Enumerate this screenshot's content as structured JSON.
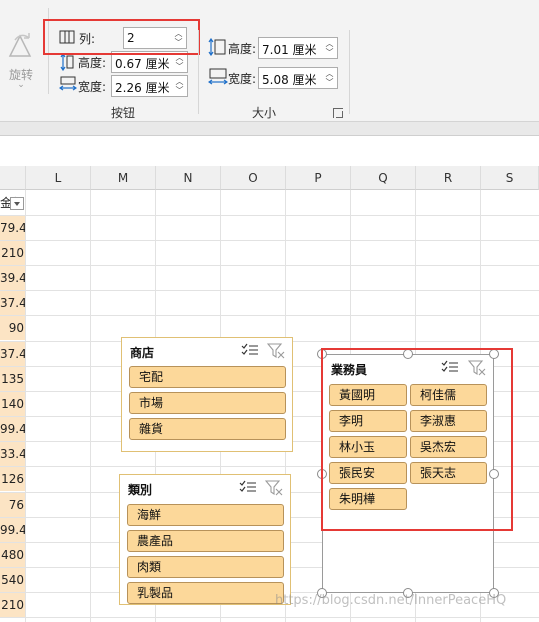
{
  "ribbon": {
    "rotate_label": "旋转",
    "rotate_dropdown_glyph": "⌄",
    "columns": {
      "label": "列:",
      "value": "2"
    },
    "button_height": {
      "label": "高度:",
      "value": "0.67 厘米"
    },
    "button_width": {
      "label": "宽度:",
      "value": "2.26 厘米"
    },
    "size_height": {
      "label": "高度:",
      "value": "7.01 厘米"
    },
    "size_width": {
      "label": "宽度:",
      "value": "5.08 厘米"
    },
    "group_buttons": "按钮",
    "group_size": "大小"
  },
  "sheet": {
    "columns": [
      "L",
      "M",
      "N",
      "O",
      "P",
      "Q",
      "R",
      "S"
    ],
    "col_a_header": "金額",
    "col_a_values": [
      "79.4",
      "210",
      "39.4",
      "37.4",
      "90",
      "37.4",
      "135",
      "140",
      "99.4",
      "33.4",
      "126",
      "76",
      "99.4",
      "480",
      "540",
      "210"
    ]
  },
  "slicers": {
    "store": {
      "title": "商店",
      "items": [
        "宅配",
        "市場",
        "雜貨"
      ]
    },
    "category": {
      "title": "類別",
      "items": [
        "海鮮",
        "農產品",
        "肉類",
        "乳製品"
      ]
    },
    "salesperson": {
      "title": "業務員",
      "items": [
        "黃國明",
        "柯佳儒",
        "李明",
        "李淑惠",
        "林小玉",
        "吳杰宏",
        "張民安",
        "張天志",
        "朱明樺"
      ]
    }
  },
  "watermark": "https://blog.csdn.net/InnerPeaceHQ",
  "colors": {
    "accent_red": "#e53935",
    "slicer_item": "#fcd89a",
    "slicer_border": "#e0c074"
  }
}
